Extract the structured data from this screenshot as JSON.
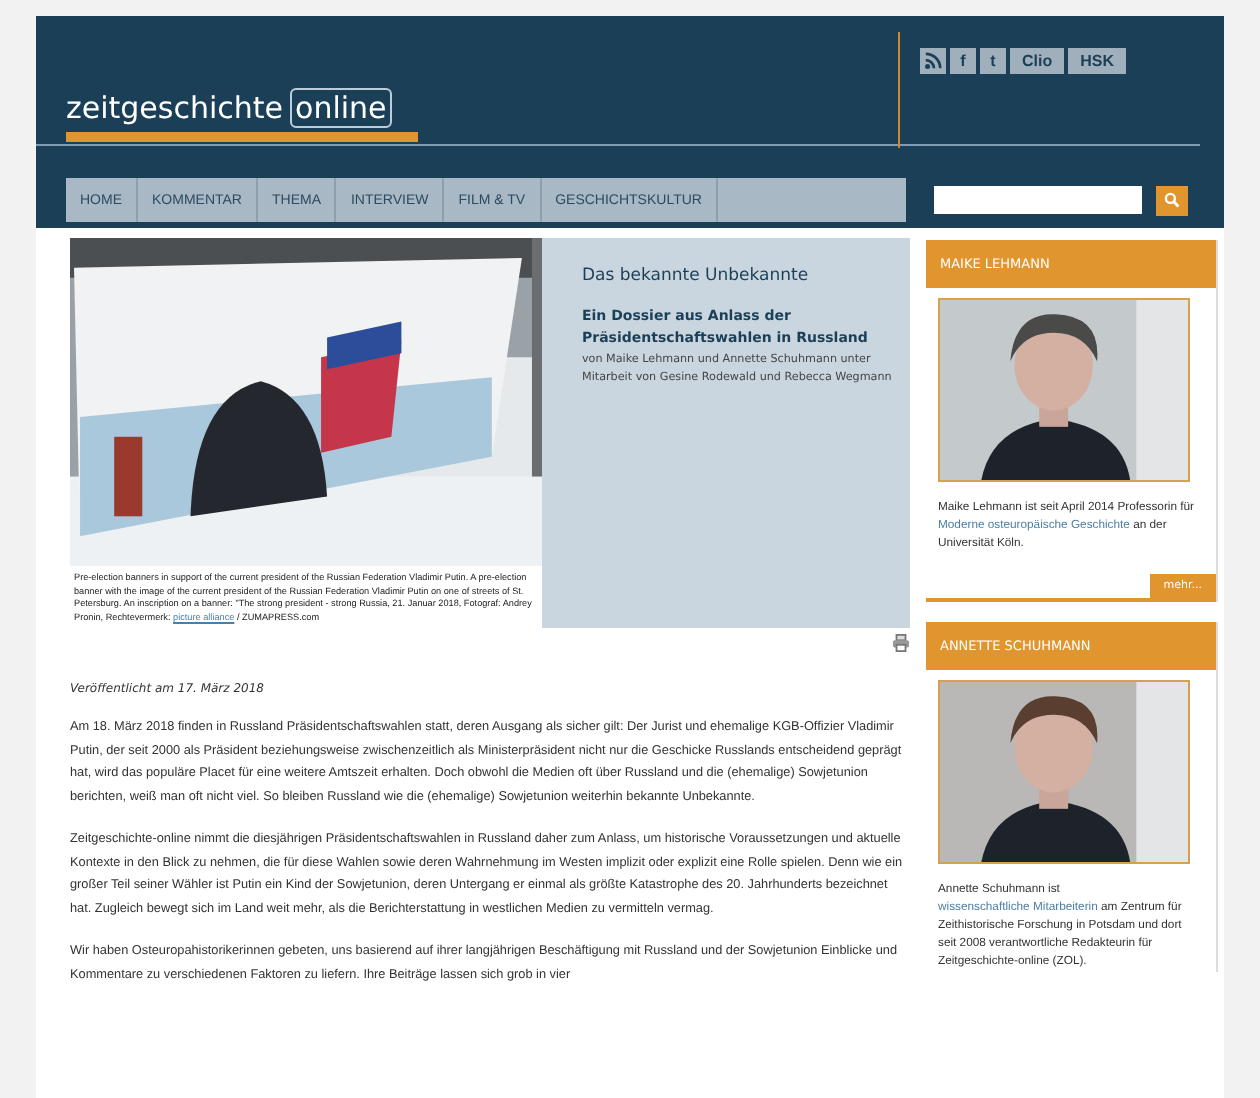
{
  "logo": {
    "main": "zeitgeschichte",
    "boxed": "online"
  },
  "social": [
    {
      "kind": "rss"
    },
    {
      "kind": "text",
      "label": "f"
    },
    {
      "kind": "text",
      "label": "t"
    },
    {
      "kind": "text",
      "label": "Clio"
    },
    {
      "kind": "text",
      "label": "HSK"
    }
  ],
  "nav": [
    {
      "label": "HOME",
      "selected": false
    },
    {
      "label": "KOMMENTAR",
      "selected": false
    },
    {
      "label": "THEMA",
      "selected": false
    },
    {
      "label": "INTERVIEW",
      "selected": false
    },
    {
      "label": "FILM & TV",
      "selected": false
    },
    {
      "label": "GESCHICHTSKULTUR",
      "selected": false
    }
  ],
  "feature": {
    "caption": [
      {
        "text": "Pre-election banners in support of the current president of the Russian Federation Vladimir Putin. A pre-election banner with the image of the current president of the Russian Federation Vladimir Putin on one of streets of St. Petersburg. An inscription on a banner: \"The strong president - strong Russia, 21. Januar 2018, Fotograf: Andrey Pronin, Rechtevermerk: ",
        "link": false
      },
      {
        "text": "picture alliance",
        "link": true
      },
      {
        "text": " / ZUMAPRESS.com",
        "link": false
      }
    ],
    "title": "Das bekannte Unbekannte",
    "subtitle": "Ein Dossier aus Anlass der Präsidentschaftswahlen in Russland",
    "byline": "von  Maike Lehmann und Annette Schuhmann  unter Mitarbeit von  Gesine Rodewald und Rebecca Wegmann"
  },
  "published": "Veröffentlicht am 17. März 2018",
  "paragraphs": [
    "Am 18. März 2018 finden in Russland Präsidentschaftswahlen statt, deren Ausgang als sicher gilt: Der Jurist und ehemalige KGB-Offizier Vladimir Putin, der seit 2000 als Präsident beziehungsweise zwischenzeitlich als Ministerpräsident nicht nur die Geschicke Russlands entscheidend geprägt hat, wird das populäre Placet für eine weitere Amtszeit erhalten. Doch obwohl die Medien oft über Russland und die (ehemalige) Sowjetunion berichten, weiß man oft nicht viel. So bleiben Russland wie die (ehemalige) Sowjetunion weiterhin bekannte Unbekannte.",
    "Zeitgeschichte-online nimmt die diesjährigen Präsidentschaftswahlen in Russland daher zum Anlass, um historische Voraussetzungen und aktuelle Kontexte in den Blick zu nehmen, die für diese Wahlen sowie deren Wahrnehmung im Westen implizit oder explizit eine Rolle spielen. Denn wie ein großer Teil seiner Wähler ist Putin ein Kind der Sowjetunion, deren Untergang er einmal als größte Katastrophe des 20. Jahrhunderts bezeichnet hat. Zugleich bewegt sich im Land weit mehr, als die Berichterstattung in westlichen Medien zu vermitteln vermag.",
    "Wir haben Osteuropahistorikerinnen gebeten, uns basierend auf ihrer langjährigen Beschäftigung mit Russland und der Sowjetunion Einblicke und Kommentare zu verschiedenen Faktoren zu liefern. Ihre Beiträge lassen sich grob in vier"
  ],
  "authors": [
    {
      "name": "MAIKE LEHMANN",
      "bio": [
        {
          "text": "Maike Lehmann ist seit April 2014 Professorin für ",
          "link": false
        },
        {
          "text": "Moderne osteuropäische Geschichte",
          "link": true
        },
        {
          "text": " an der Universität Köln.",
          "link": false
        }
      ],
      "more": "mehr..."
    },
    {
      "name": "ANNETTE SCHUHMANN",
      "bio": [
        {
          "text": "Annette Schuhmann ist ",
          "link": false
        },
        {
          "text": "wissenschaftliche Mitarbeiterin",
          "link": true
        },
        {
          "text": " am Zentrum für Zeithistorische Forschung in Potsdam und dort seit 2008 verantwortliche Redakteurin für Zeitgeschichte-online (ZOL).",
          "link": false
        }
      ]
    }
  ]
}
